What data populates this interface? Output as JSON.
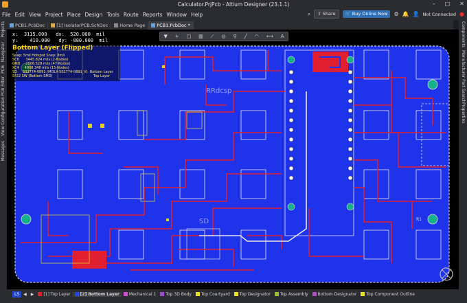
{
  "window": {
    "title": "Calculator.PrjPcb - Altium Designer (23.1.1)",
    "controls": [
      "–",
      "□",
      "✕"
    ]
  },
  "menu": {
    "items": [
      "File",
      "Edit",
      "View",
      "Project",
      "Place",
      "Design",
      "Tools",
      "Route",
      "Reports",
      "Window",
      "Help"
    ],
    "share_label": "Share",
    "buy_label": "Buy Online Now",
    "not_connected": "Not Connected"
  },
  "tabs": [
    {
      "label": "PCB1.PcbDoc"
    },
    {
      "label": "[1] IsolatorPCB.SchDoc"
    },
    {
      "label": "Home Page"
    },
    {
      "label": "PCB1.PcbDoc *"
    }
  ],
  "left_panels": [
    "Projects",
    "Navigator",
    "PCB",
    "PCB Filter",
    "View Configuration",
    "Messages"
  ],
  "right_panels": [
    "Components",
    "Manufacturer Part Search",
    "Properties"
  ],
  "hud": {
    "line1": "x:  3115.000   dx:  520.000  mil",
    "line2": "y:    410.000   dy: -880.000  mil",
    "layer": "Bottom Layer (Flipped)",
    "snap": "Snap: 5mil Hotspot Snap: 8mil",
    "sck": "SCK      3445.824 mils (2-Nodes)",
    "gnd": "GND     2506.528 mils (47-Nodes)",
    "xc4": "XC4     4908.348 mils (15-Nodes)",
    "sd": "SD     502774-0891 (MOLX-502774-0891_V)  Bottom Layer",
    "sw": "S*22 SW (Bottom SMD)",
    "sw_layer": "Top Layer"
  },
  "board_labels": {
    "rrdcsp": "RRdcsp",
    "sd": "SD",
    "r_desig": "R1"
  },
  "layers": [
    {
      "label": "LS",
      "color": "#2546c9"
    },
    {
      "label": "[1] Top Layer",
      "color": "#e0202a"
    },
    {
      "label": "[2] Bottom Layer",
      "color": "#2546e0"
    },
    {
      "label": "Mechanical 1",
      "color": "#d04cd0"
    },
    {
      "label": "Top 3D Body",
      "color": "#9b4cd0"
    },
    {
      "label": "Top Courtyard",
      "color": "#e8e020"
    },
    {
      "label": "Top Designator",
      "color": "#e8e020"
    },
    {
      "label": "Top Assembly",
      "color": "#9bbe3a"
    },
    {
      "label": "Bottom Designator",
      "color": "#b050c0"
    },
    {
      "label": "Top Component Outline",
      "color": "#e8e020"
    }
  ],
  "toolbar_icons": [
    "filter-icon",
    "add-icon",
    "rect-icon",
    "chart-icon",
    "route-icon",
    "via-icon",
    "text-icon",
    "pin-icon",
    "line-icon",
    "arc-icon",
    "measure-icon",
    "A"
  ]
}
